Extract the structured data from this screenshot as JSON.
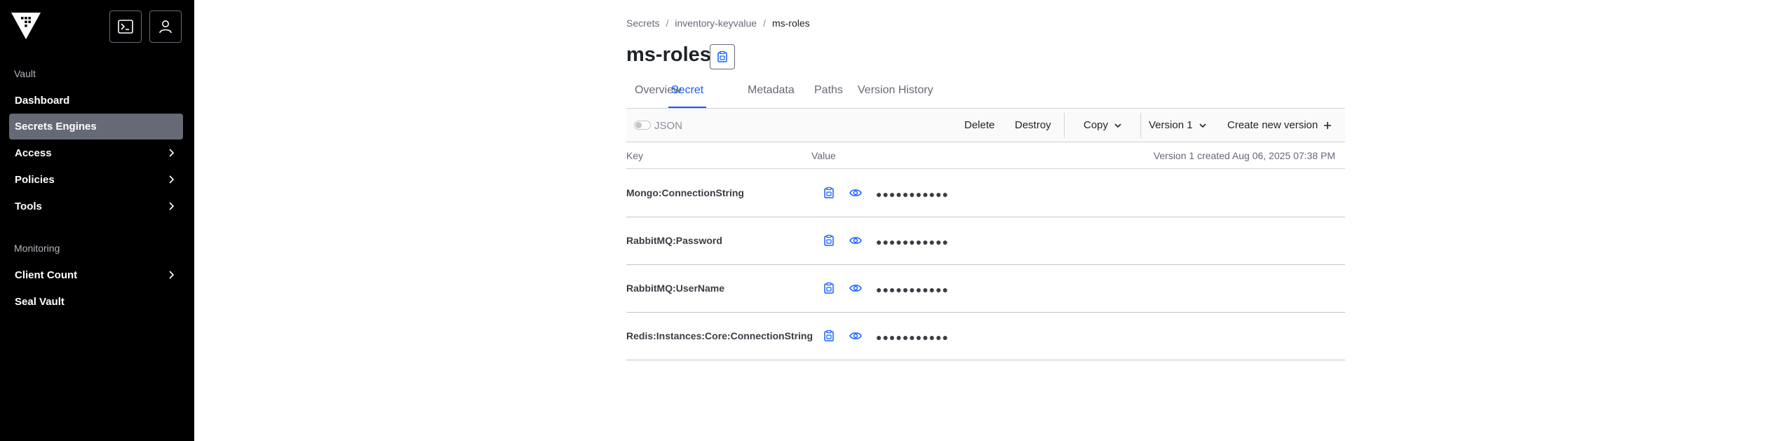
{
  "sidebar": {
    "sections": [
      {
        "heading": "Vault",
        "items": [
          {
            "label": "Dashboard"
          },
          {
            "label": "Secrets Engines"
          },
          {
            "label": "Access"
          },
          {
            "label": "Policies"
          },
          {
            "label": "Tools"
          }
        ]
      },
      {
        "heading": "Monitoring",
        "items": [
          {
            "label": "Client Count"
          },
          {
            "label": "Seal Vault"
          }
        ]
      }
    ],
    "active_item": "Secrets Engines",
    "header_icons": [
      "terminal-icon",
      "user-icon"
    ]
  },
  "breadcrumb": [
    "Secrets",
    "inventory-keyvalue",
    "ms-roles"
  ],
  "title": "ms-roles",
  "tabs": [
    {
      "label": "Overview"
    },
    {
      "label": "Secret"
    },
    {
      "label": "Metadata"
    },
    {
      "label": "Paths"
    },
    {
      "label": "Version History"
    }
  ],
  "active_tab": "Secret",
  "toolbar": {
    "json_label": "JSON",
    "json_toggle_on": false,
    "delete_label": "Delete",
    "destroy_label": "Destroy",
    "copy_label": "Copy",
    "version_label": "Version 1",
    "create_label": "Create new version"
  },
  "table": {
    "key_header": "Key",
    "value_header": "Value",
    "version_info": "Version 1 created Aug 06, 2025 07:38 PM",
    "rows": [
      {
        "key": "Mongo:ConnectionString",
        "masked": "●●●●●●●●●●●"
      },
      {
        "key": "RabbitMQ:Password",
        "masked": "●●●●●●●●●●●"
      },
      {
        "key": "RabbitMQ:UserName",
        "masked": "●●●●●●●●●●●"
      },
      {
        "key": "Redis:Instances:Core:ConnectionString",
        "masked": "●●●●●●●●●●●"
      }
    ]
  },
  "colors": {
    "sidebar_bg": "#000000",
    "active_nav_bg": "#656a76",
    "accent": "#1060ff"
  }
}
